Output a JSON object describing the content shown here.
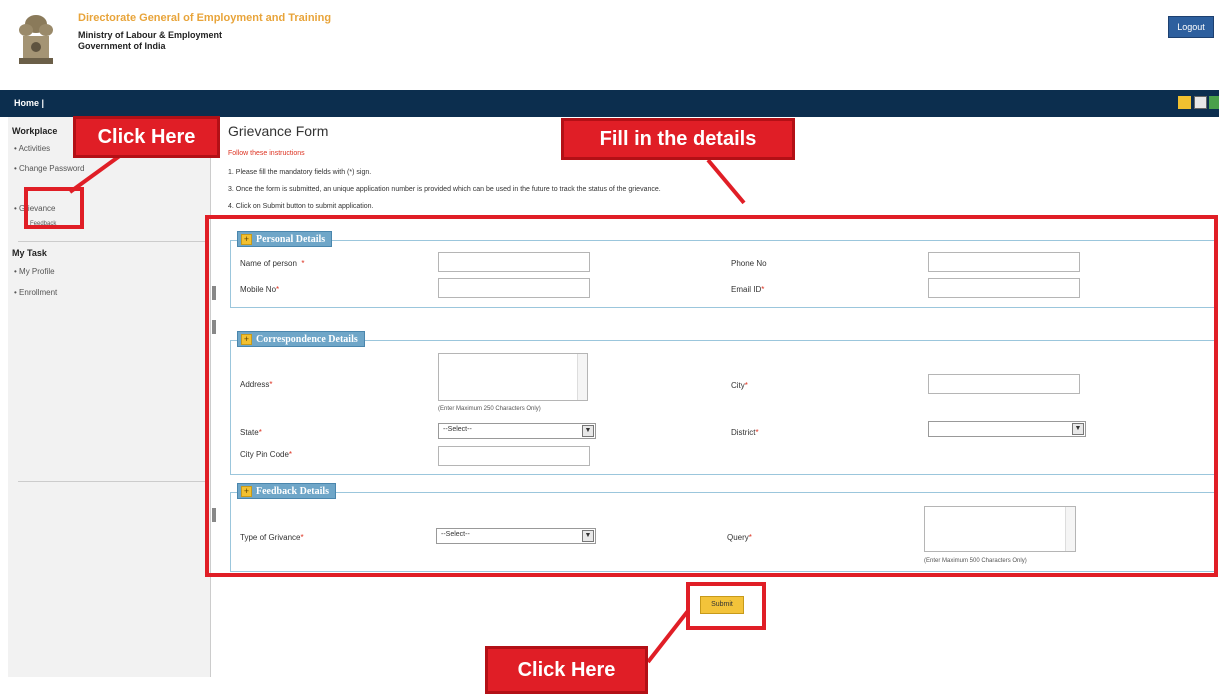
{
  "header": {
    "org_title": "Directorate General of Employment and Training",
    "ministry_line1": "Ministry of Labour & Employment",
    "ministry_line2": "Government of India",
    "logout_label": "Logout"
  },
  "nav": {
    "home_label": "Home |"
  },
  "sidebar": {
    "workplace_label": "Workplace",
    "items": [
      "Activities",
      "Change Password",
      "Grievance",
      "Feedback"
    ],
    "mytask_label": "My Task",
    "task_items": [
      "My Profile",
      "Enrollment"
    ]
  },
  "form": {
    "title": "Grievance Form",
    "instructions_head": "Follow these instructions",
    "instructions": [
      "1. Please fill the mandatory fields with (*) sign.",
      "3. Once the form is submitted, an unique application number is provided which can be used in the future to track the status of the grievance.",
      "4. Click on Submit button to submit application."
    ],
    "personal": {
      "legend": "Personal Details",
      "name_label": "Name of person",
      "phone_label": "Phone No",
      "mobile_label": "Mobile No",
      "email_label": "Email ID"
    },
    "correspondence": {
      "legend": "Correspondence Details",
      "address_label": "Address",
      "address_hint": "(Enter Maximum 250 Characters Only)",
      "city_label": "City",
      "state_label": "State",
      "state_value": "--Select--",
      "district_label": "District",
      "district_value": "",
      "pin_label": "City Pin Code"
    },
    "feedback": {
      "legend": "Feedback Details",
      "type_label": "Type of Grivance",
      "type_value": "--Select--",
      "query_label": "Query",
      "query_hint": "(Enter Maximum 500 Characters Only)"
    },
    "submit_label": "Submit"
  },
  "annotations": {
    "click_here_top": "Click Here",
    "fill_details": "Fill in the details",
    "click_here_bottom": "Click Here"
  },
  "colors": {
    "nav_bg": "#0c2e4e",
    "annotation_red": "#e01e26",
    "legend_blue": "#6fa6c8",
    "submit_yellow": "#f3c33a"
  }
}
